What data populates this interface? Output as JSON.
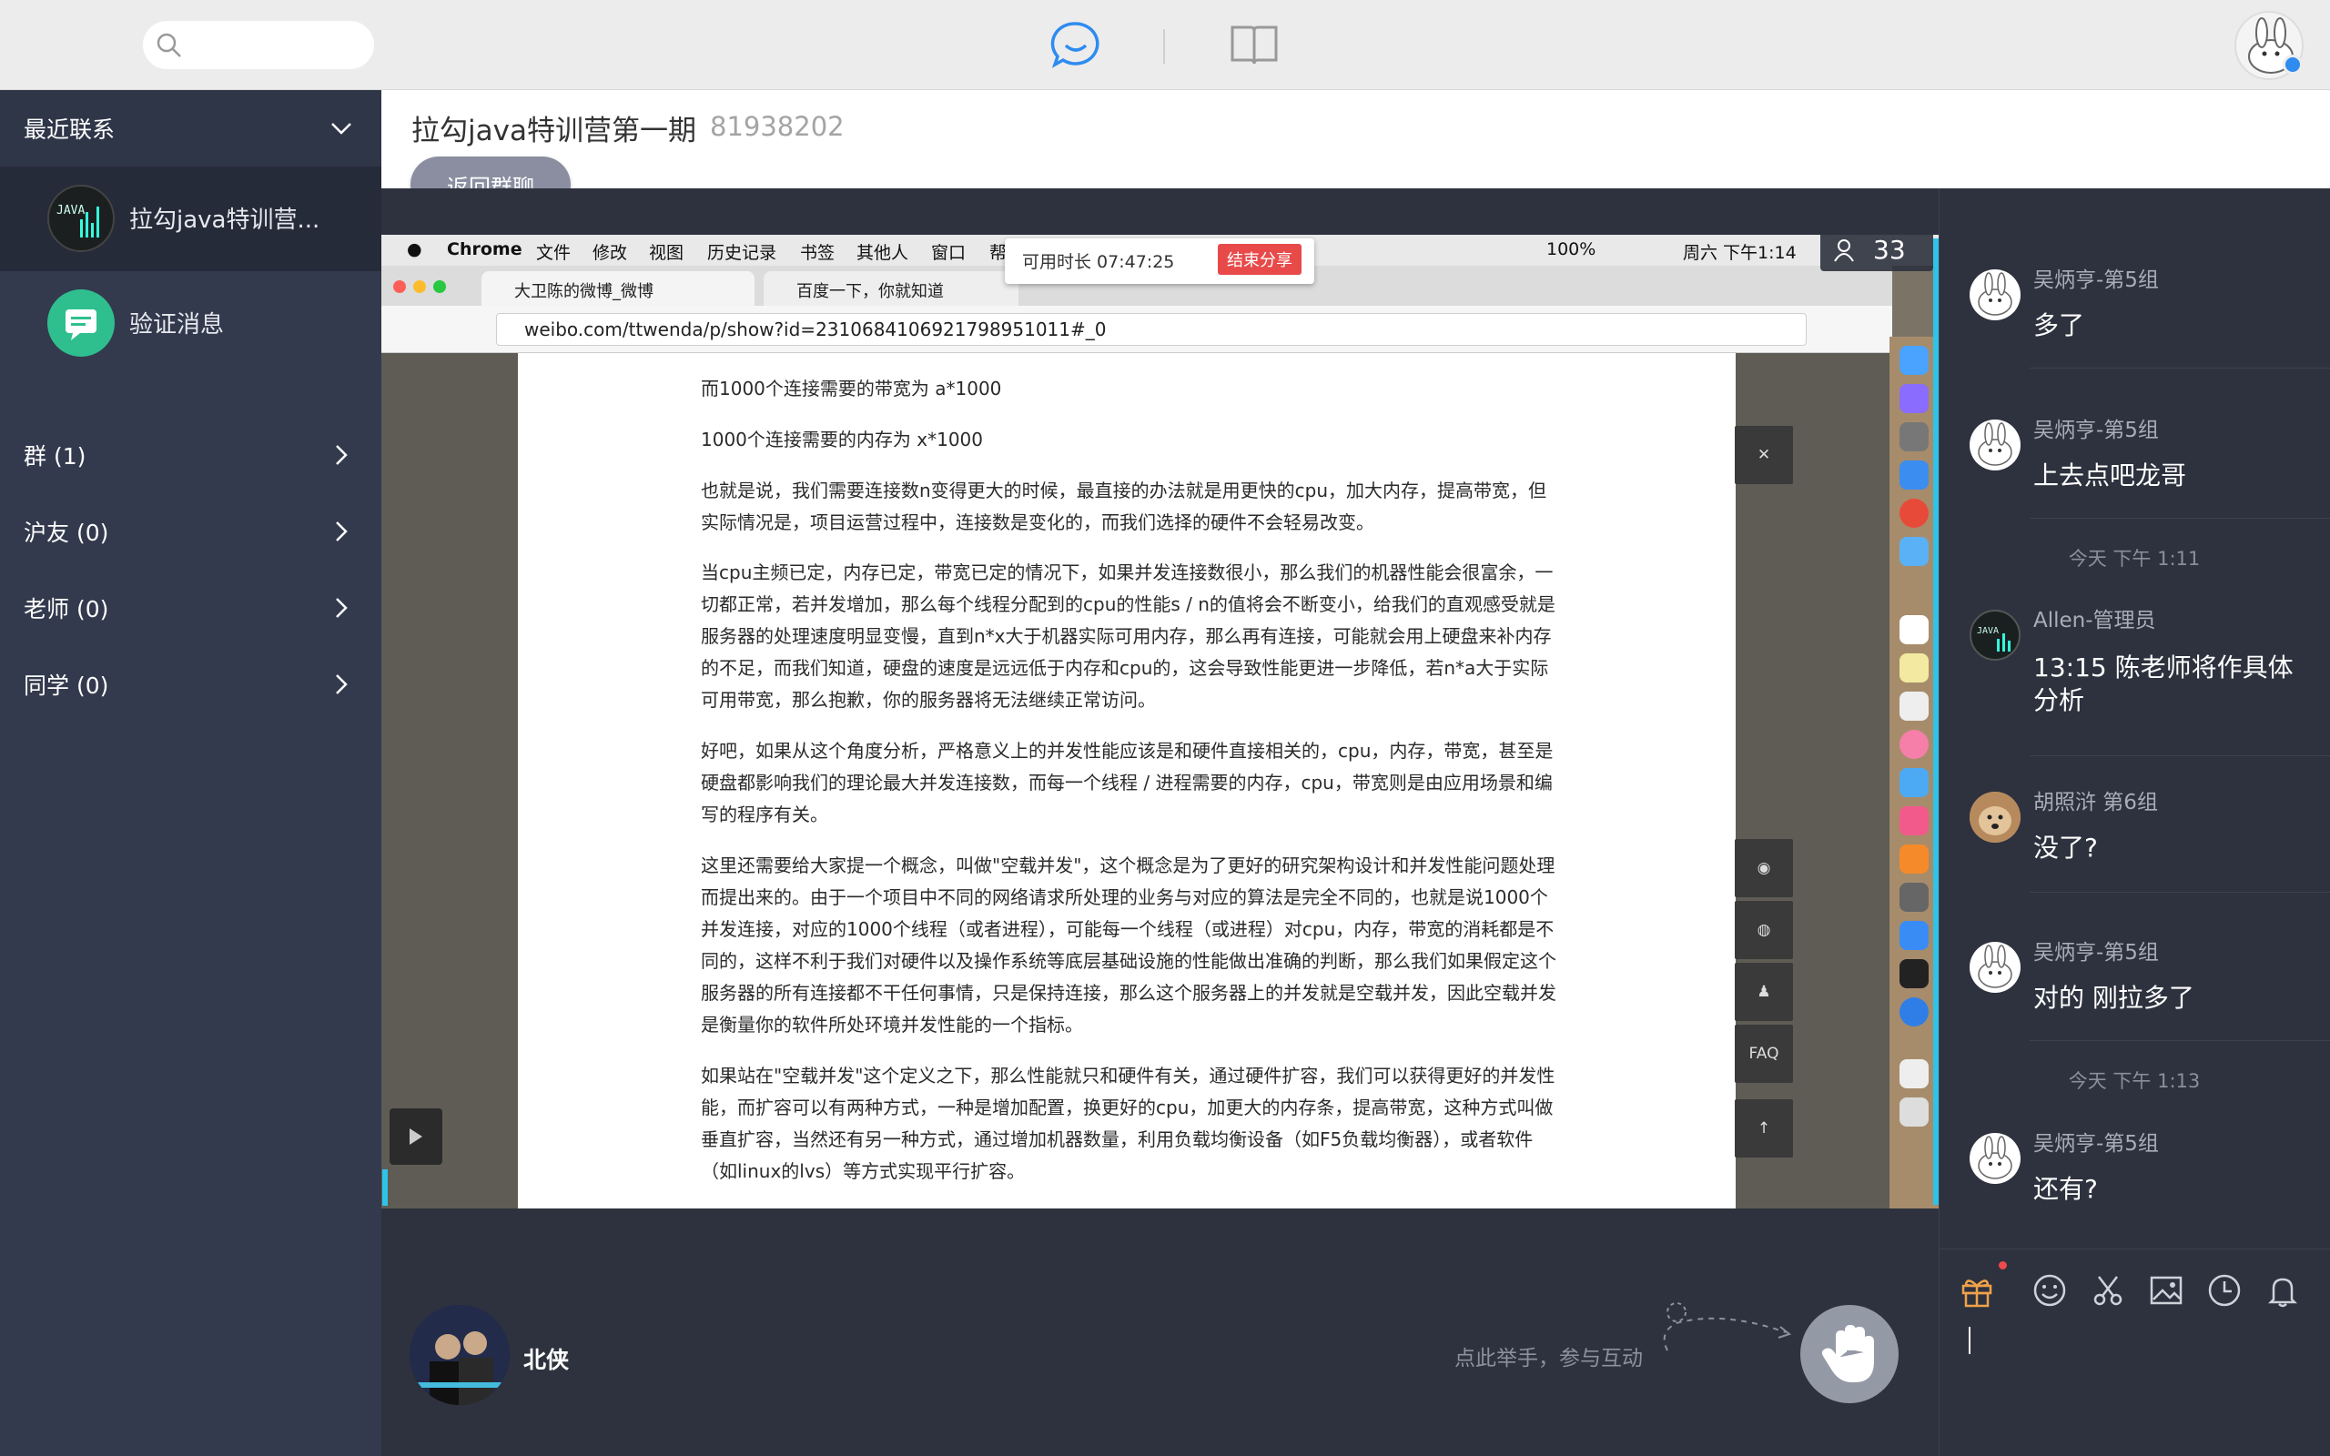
{
  "topbar": {
    "search_placeholder": "",
    "tabs": [
      {
        "name": "chat",
        "active": true
      },
      {
        "name": "contacts-book",
        "active": false
      }
    ],
    "accent": "#2e8bf0"
  },
  "sidebar": {
    "recent_header": "最近联系",
    "conversations": [
      {
        "name": "拉勾java特训营...",
        "icon": "group-avatar",
        "selected": true
      },
      {
        "name": "验证消息",
        "icon": "message-icon"
      }
    ],
    "sections": [
      {
        "label": "群 (1)"
      },
      {
        "label": "沪友 (0)"
      },
      {
        "label": "老师 (0)"
      },
      {
        "label": "同学 (0)"
      }
    ]
  },
  "main": {
    "title": "拉勾java特训营第一期",
    "group_id": "81938202",
    "back_button": "返回群聊",
    "viewers": "33"
  },
  "screen_share": {
    "mac_menu": [
      "Chrome",
      "文件",
      "修改",
      "视图",
      "历史记录",
      "书签",
      "其他人",
      "窗口",
      "帮"
    ],
    "mac_status": [
      "100%",
      "周六 下午1:14"
    ],
    "share_time": "可用时长 07:47:25",
    "stop_share": "结束分享",
    "browser_tabs": [
      "大卫陈的微博_微博",
      "百度一下，你就知道"
    ],
    "url": "weibo.com/ttwenda/p/show?id=2310684106921798951011#_0",
    "paragraphs": [
      "而1000个连接需要的带宽为 a*1000",
      "1000个连接需要的内存为 x*1000",
      "也就是说，我们需要连接数n变得更大的时候，最直接的办法就是用更快的cpu，加大内存，提高带宽，但实际情况是，项目运营过程中，连接数是变化的，而我们选择的硬件不会轻易改变。",
      "当cpu主频已定，内存已定，带宽已定的情况下，如果并发连接数很小，那么我们的机器性能会很富余，一切都正常，若并发增加，那么每个线程分配到的cpu的性能s / n的值将会不断变小，给我们的直观感受就是服务器的处理速度明显变慢，直到n*x大于机器实际可用内存，那么再有连接，可能就会用上硬盘来补内存的不足，而我们知道，硬盘的速度是远远低于内存和cpu的，这会导致性能更进一步降低，若n*a大于实际可用带宽，那么抱歉，你的服务器将无法继续正常访问。",
      "好吧，如果从这个角度分析，严格意义上的并发性能应该是和硬件直接相关的，cpu，内存，带宽，甚至是硬盘都影响我们的理论最大并发连接数，而每一个线程 / 进程需要的内存，cpu，带宽则是由应用场景和编写的程序有关。",
      "这里还需要给大家提一个概念，叫做\"空载并发\"，这个概念是为了更好的研究架构设计和并发性能问题处理而提出来的。由于一个项目中不同的网络请求所处理的业务与对应的算法是完全不同的，也就是说1000个并发连接，对应的1000个线程（或者进程），可能每一个线程（或进程）对cpu，内存，带宽的消耗都是不同的，这样不利于我们对硬件以及操作系统等底层基础设施的性能做出准确的判断，那么我们如果假定这个服务器的所有连接都不干任何事情，只是保持连接，那么这个服务器上的并发就是空载并发，因此空载并发是衡量你的软件所处环境并发性能的一个指标。",
      "如果站在\"空载并发\"这个定义之下，那么性能就只和硬件有关，通过硬件扩容，我们可以获得更好的并发性能，而扩容可以有两种方式，一种是增加配置，换更好的cpu，加更大的内存条，提高带宽，这种方式叫做垂直扩容，当然还有另一种方式，通过增加机器数量，利用负载均衡设备（如F5负载均衡器），或者软件（如linux的lvs）等方式实现平行扩容。"
    ],
    "side_tools": [
      "weibo-icon",
      "wechat-icon",
      "bell-icon",
      "FAQ",
      "up-arrow-icon"
    ]
  },
  "presenter": {
    "name": "北侠"
  },
  "raise_hand": {
    "hint": "点此举手，参与互动"
  },
  "chat": {
    "items": [
      {
        "type": "msg",
        "sender": "吴炳亨-第5组",
        "text": "多了",
        "avatar": "rabbit"
      },
      {
        "type": "msg",
        "sender": "吴炳亨-第5组",
        "text": "上去点吧龙哥",
        "avatar": "rabbit"
      },
      {
        "type": "time",
        "text": "今天 下午 1:11"
      },
      {
        "type": "msg",
        "sender": "Allen-管理员",
        "text": "13:15 陈老师将作具体分析",
        "avatar": "java"
      },
      {
        "type": "msg",
        "sender": "胡照浒 第6组",
        "text": "没了?",
        "avatar": "dog"
      },
      {
        "type": "msg",
        "sender": "吴炳亨-第5组",
        "text": "对的 刚拉多了",
        "avatar": "rabbit"
      },
      {
        "type": "time",
        "text": "今天 下午 1:13"
      },
      {
        "type": "msg",
        "sender": "吴炳亨-第5组",
        "text": "还有?",
        "avatar": "rabbit"
      }
    ],
    "composer_tools": [
      "gift-icon",
      "emoji-icon",
      "scissors-icon",
      "image-icon",
      "clock-icon",
      "bell-icon"
    ]
  }
}
